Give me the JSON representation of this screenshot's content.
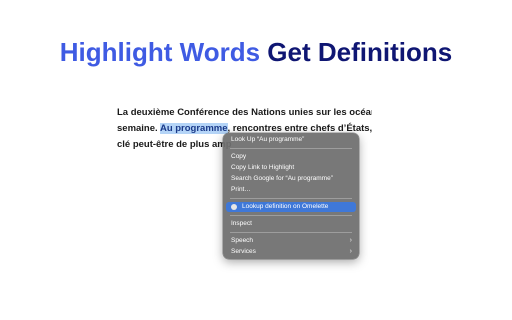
{
  "headline": {
    "part1": "Highlight Words",
    "part2": "Get Definitions"
  },
  "article": {
    "line1": "La deuxième Conférence des Nations unies sur les océans",
    "line2_before": "semaine. ",
    "line2_selected": "Au programme",
    "line2_after": ", rencontres entre chefs d’États, m",
    "line3": "clé peut-être de plus amp"
  },
  "context_menu": {
    "look_up": "Look Up “Au programme”",
    "copy": "Copy",
    "copy_link": "Copy Link to Highlight",
    "search_google": "Search Google for “Au programme”",
    "print": "Print…",
    "omelette": "Lookup definition on Omelette",
    "inspect": "Inspect",
    "speech": "Speech",
    "services": "Services",
    "submenu_arrow": "›"
  },
  "colors": {
    "headline_primary": "#3f5be3",
    "headline_secondary": "#0f1673",
    "selection": "#b4d4f7",
    "menu_background": "#707070",
    "menu_active": "#3f78d8"
  }
}
